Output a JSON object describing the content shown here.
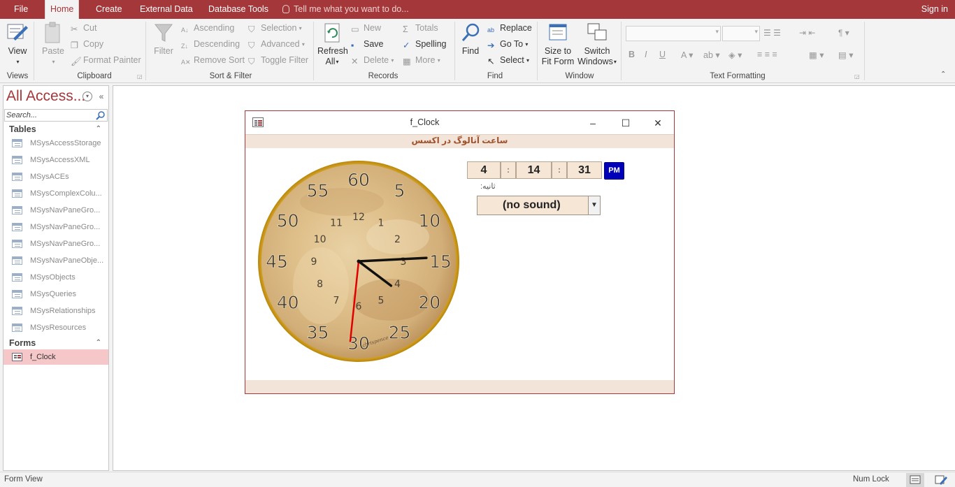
{
  "tabs": {
    "file": "File",
    "home": "Home",
    "create": "Create",
    "external": "External Data",
    "dbtools": "Database Tools",
    "tellme": "Tell me what you want to do...",
    "signin": "Sign in"
  },
  "ribbon": {
    "views": {
      "view": "View",
      "group": "Views"
    },
    "clipboard": {
      "paste": "Paste",
      "cut": "Cut",
      "copy": "Copy",
      "format_painter": "Format Painter",
      "group": "Clipboard"
    },
    "sortfilter": {
      "filter": "Filter",
      "ascending": "Ascending",
      "descending": "Descending",
      "remove_sort": "Remove Sort",
      "selection": "Selection",
      "advanced": "Advanced",
      "toggle_filter": "Toggle Filter",
      "group": "Sort & Filter"
    },
    "records": {
      "refresh": "Refresh",
      "refresh2": "All",
      "new": "New",
      "save": "Save",
      "delete": "Delete",
      "totals": "Totals",
      "spelling": "Spelling",
      "more": "More",
      "group": "Records"
    },
    "find": {
      "find": "Find",
      "replace": "Replace",
      "goto": "Go To",
      "select": "Select",
      "group": "Find"
    },
    "window": {
      "size_fit": "Size to",
      "size_fit2": "Fit Form",
      "switch": "Switch",
      "switch2": "Windows",
      "group": "Window"
    },
    "text": {
      "group": "Text Formatting",
      "bold": "B",
      "italic": "I",
      "underline": "U"
    }
  },
  "nav": {
    "title": "All Access...",
    "search_placeholder": "Search...",
    "tables_header": "Tables",
    "tables": [
      "MSysAccessStorage",
      "MSysAccessXML",
      "MSysACEs",
      "MSysComplexColu...",
      "MSysNavPaneGro...",
      "MSysNavPaneGro...",
      "MSysNavPaneGro...",
      "MSysNavPaneObje...",
      "MSysObjects",
      "MSysQueries",
      "MSysRelationships",
      "MSysResources"
    ],
    "forms_header": "Forms",
    "forms": [
      "f_Clock"
    ]
  },
  "form": {
    "caption": "f_Clock",
    "header": "ساعت آنالوگ در اکسس",
    "hours": "4",
    "minutes": "14",
    "seconds": "31",
    "sep": ":",
    "ampm": "PM",
    "seconds_label": "ثانیه:",
    "sound": "(no sound)",
    "clock": {
      "outer_numbers": [
        "60",
        "5",
        "10",
        "15",
        "20",
        "25",
        "30",
        "35",
        "40",
        "45",
        "50",
        "55"
      ],
      "inner_numbers": [
        "12",
        "1",
        "2",
        "3",
        "4",
        "5",
        "6",
        "7",
        "8",
        "9",
        "10",
        "11"
      ],
      "signature": "chrispence",
      "time": {
        "hour": 4,
        "minute": 14,
        "second": 31
      }
    }
  },
  "status": {
    "view": "Form View",
    "numlock": "Num Lock"
  },
  "colors": {
    "accent": "#a4373a",
    "form_band": "#f2e4d9",
    "pm_button": "#0000b8",
    "second_hand": "#e00000"
  }
}
